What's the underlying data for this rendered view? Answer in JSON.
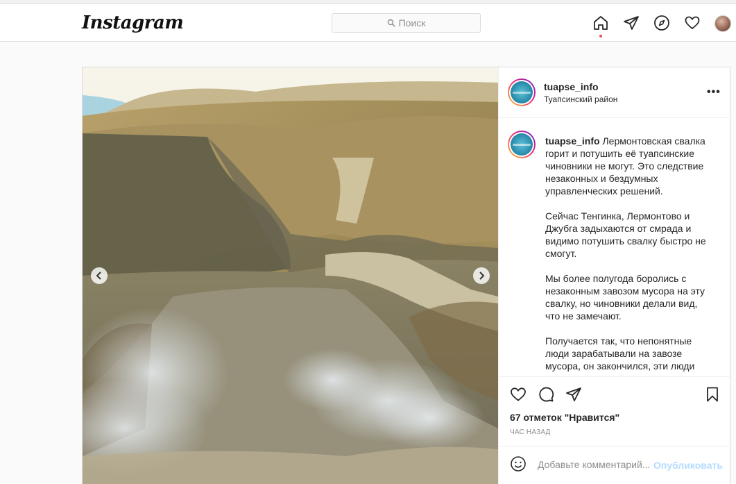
{
  "header": {
    "logo": "Instagram",
    "search_placeholder": "Поиск",
    "nav_icons": [
      "home-icon",
      "direct-icon",
      "explore-icon",
      "activity-heart-icon",
      "profile-avatar"
    ],
    "notification_color": "#ed4956"
  },
  "post": {
    "username": "tuapse_info",
    "location": "Туапсинский район",
    "more_label": "•••",
    "caption_paragraphs": [
      "Лермонтовская свалка горит и потушить её туапсинские чиновники не могут. Это следствие незаконных и бездумных управленческих решений.",
      "Сейчас Тенгинка, Лермонтово и Джубга задыхаются от смрада и видимо потушить свалку быстро не смогут.",
      "Мы более полугода боролись с незаконным завозом мусора на эту свалку, но чиновники делали вид, что не замечают.",
      "Получается так, что непонятные люди зарабатывали на завозе мусора, он закончился, эти люди ушли."
    ],
    "likes": "67 отметок \"Нравится\"",
    "time": "час назад",
    "comment_placeholder": "Добавьте комментарий...",
    "publish_label": "Опубликовать",
    "publish_color": "#b3dbff",
    "carousel": {
      "prev_icon": "chevron-left-icon",
      "next_icon": "chevron-right-icon"
    }
  }
}
